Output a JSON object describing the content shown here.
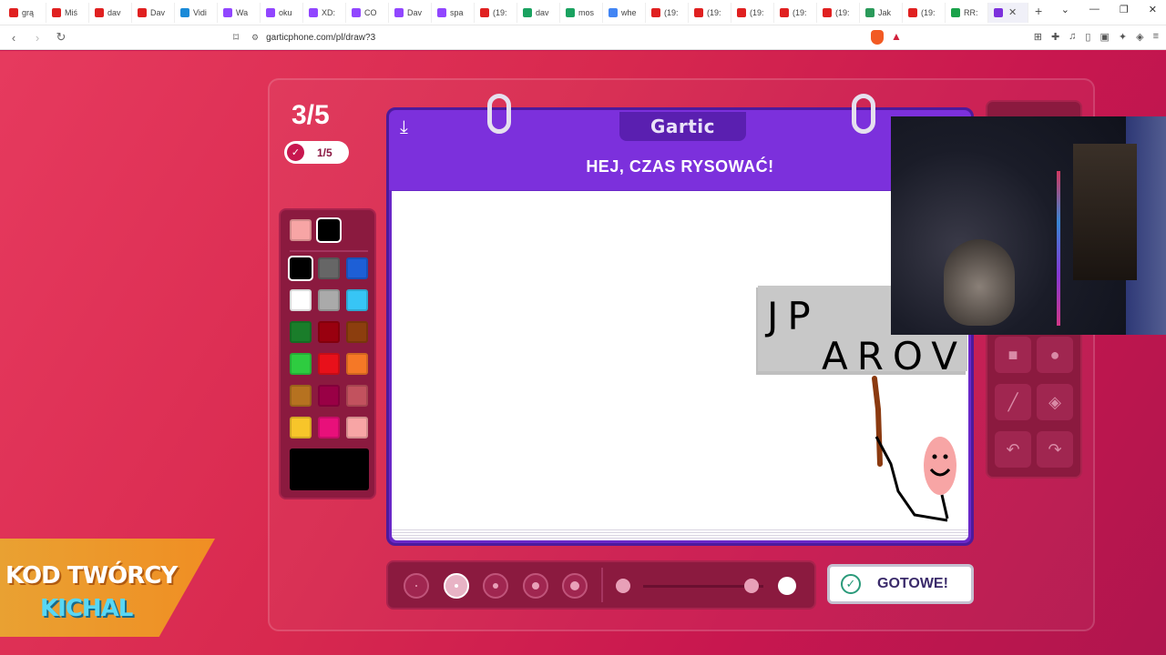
{
  "browser": {
    "tabs": [
      {
        "label": "grą",
        "color": "#e02020"
      },
      {
        "label": "Miś",
        "color": "#e02020"
      },
      {
        "label": "dav",
        "color": "#e02020"
      },
      {
        "label": "Dav",
        "color": "#e02020"
      },
      {
        "label": "Vidi",
        "color": "#1a8ad8"
      },
      {
        "label": "Wa",
        "color": "#9146ff"
      },
      {
        "label": "oku",
        "color": "#9146ff"
      },
      {
        "label": "XD:",
        "color": "#9146ff"
      },
      {
        "label": "CO",
        "color": "#9146ff"
      },
      {
        "label": "Dav",
        "color": "#9146ff"
      },
      {
        "label": "spa",
        "color": "#9146ff"
      },
      {
        "label": "(19:",
        "color": "#e02020"
      },
      {
        "label": "dav",
        "color": "#1aa260"
      },
      {
        "label": "mos",
        "color": "#1aa260"
      },
      {
        "label": "whe",
        "color": "#4285f4"
      },
      {
        "label": "(19:",
        "color": "#e02020"
      },
      {
        "label": "(19:",
        "color": "#e02020"
      },
      {
        "label": "(19:",
        "color": "#e02020"
      },
      {
        "label": "(19:",
        "color": "#e02020"
      },
      {
        "label": "(19:",
        "color": "#e02020"
      },
      {
        "label": "Jak",
        "color": "#2a9a5a"
      },
      {
        "label": "(19:",
        "color": "#e02020"
      },
      {
        "label": "RR:",
        "color": "#1aa24a"
      }
    ],
    "url": "garticphone.com/pl/draw?3"
  },
  "game": {
    "round": "3/5",
    "done_count": "1/5",
    "logo": "Gartic",
    "prompt": "HEJ, CZAS RYSOWAĆ!",
    "submit_label": "GOTOWE!",
    "selected_brush_size_index": 1,
    "opacity_level": 0.9
  },
  "palette": {
    "current": [
      "#f7a5a5",
      "#000000"
    ],
    "colors": [
      "#000000",
      "#666666",
      "#1d5fd6",
      "#ffffff",
      "#aaaaaa",
      "#37c5f5",
      "#1a7d2a",
      "#99000f",
      "#8c3e0e",
      "#2ecc40",
      "#e8101a",
      "#f57826",
      "#b67220",
      "#990045",
      "#c2525e",
      "#f7c52a",
      "#e8107a",
      "#f7a5a5"
    ],
    "selected_index": 0
  },
  "drawing": {
    "sign_text_line1": "JP",
    "sign_text_line2": "AROV",
    "sign_color": "#bfbfbf",
    "pole_color": "#8b3a10",
    "figure_color": "#f7a5a5"
  },
  "tools": {
    "icons": [
      "square-tool-icon",
      "ellipse-tool-icon",
      "line-tool-icon",
      "fill-bucket-icon",
      "undo-icon",
      "redo-icon"
    ]
  },
  "overlay": {
    "creator_line1": "KOD TWÓRCY",
    "creator_line2": "KICHAL"
  }
}
